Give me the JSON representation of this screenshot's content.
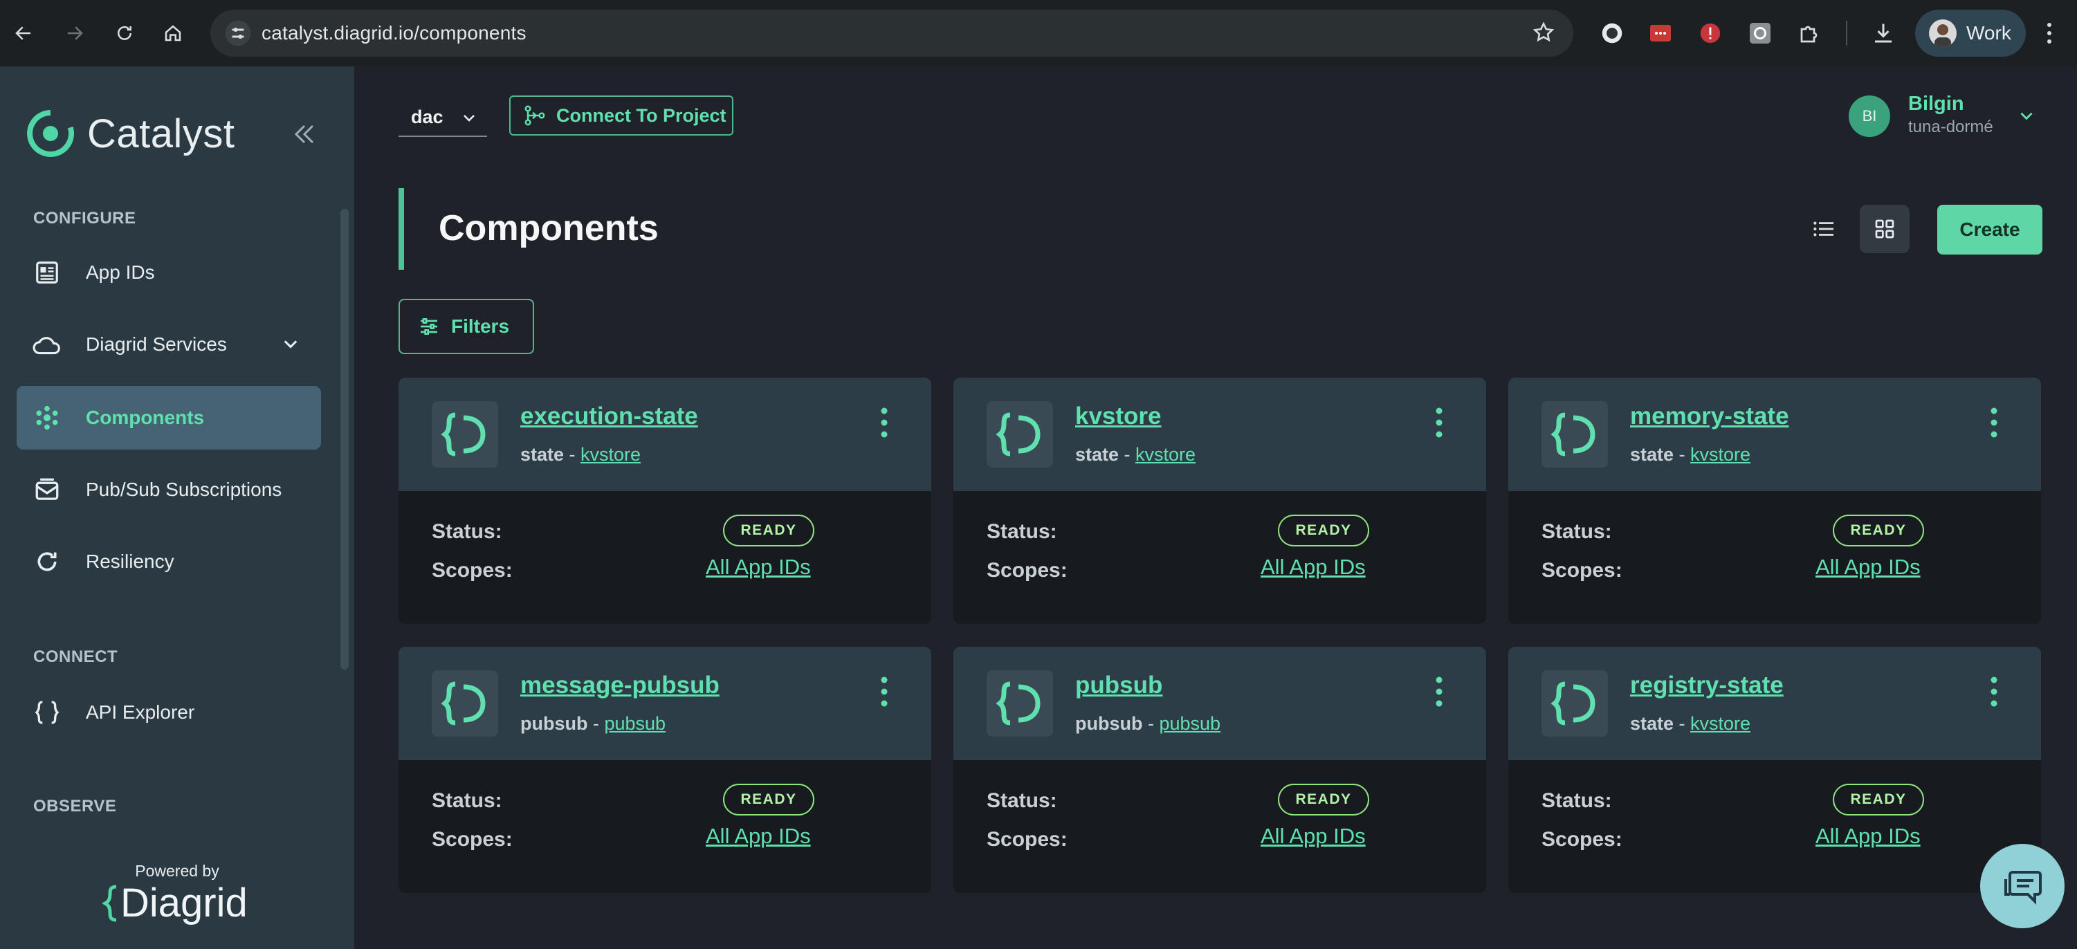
{
  "browser": {
    "url": "catalyst.diagrid.io/components",
    "profile_label": "Work"
  },
  "sidebar": {
    "app_name": "Catalyst",
    "sections": {
      "configure": "CONFIGURE",
      "connect": "CONNECT",
      "observe": "OBSERVE"
    },
    "items": [
      {
        "label": "App IDs",
        "icon": "app-ids-icon"
      },
      {
        "label": "Diagrid Services",
        "icon": "cloud-icon"
      },
      {
        "label": "Components",
        "icon": "components-icon",
        "active": true
      },
      {
        "label": "Pub/Sub Subscriptions",
        "icon": "mail-icon"
      },
      {
        "label": "Resiliency",
        "icon": "refresh-icon"
      },
      {
        "label": "API Explorer",
        "icon": "braces-icon"
      }
    ],
    "powered_by": "Powered by",
    "vendor": "Diagrid"
  },
  "topbar": {
    "project": "dac",
    "connect_label": "Connect To Project",
    "user": {
      "initials": "BI",
      "name": "Bilgin",
      "org": "tuna-dormé"
    }
  },
  "page": {
    "title": "Components",
    "create_label": "Create",
    "filters_label": "Filters"
  },
  "labels": {
    "status": "Status:",
    "scopes": "Scopes:",
    "sep": " - "
  },
  "components": [
    {
      "name": "execution-state",
      "type": "state",
      "sub": "kvstore",
      "status": "READY",
      "scopes": "All App IDs"
    },
    {
      "name": "kvstore",
      "type": "state",
      "sub": "kvstore",
      "status": "READY",
      "scopes": "All App IDs"
    },
    {
      "name": "memory-state",
      "type": "state",
      "sub": "kvstore",
      "status": "READY",
      "scopes": "All App IDs"
    },
    {
      "name": "message-pubsub",
      "type": "pubsub",
      "sub": "pubsub",
      "status": "READY",
      "scopes": "All App IDs"
    },
    {
      "name": "pubsub",
      "type": "pubsub",
      "sub": "pubsub",
      "status": "READY",
      "scopes": "All App IDs"
    },
    {
      "name": "registry-state",
      "type": "state",
      "sub": "kvstore",
      "status": "READY",
      "scopes": "All App IDs"
    }
  ],
  "colors": {
    "accent": "#5fe0ae",
    "sidebar_bg": "#2b3a42",
    "main_bg": "#1f2329",
    "card_head": "#2d3d47",
    "badge": "#8ee57f"
  }
}
